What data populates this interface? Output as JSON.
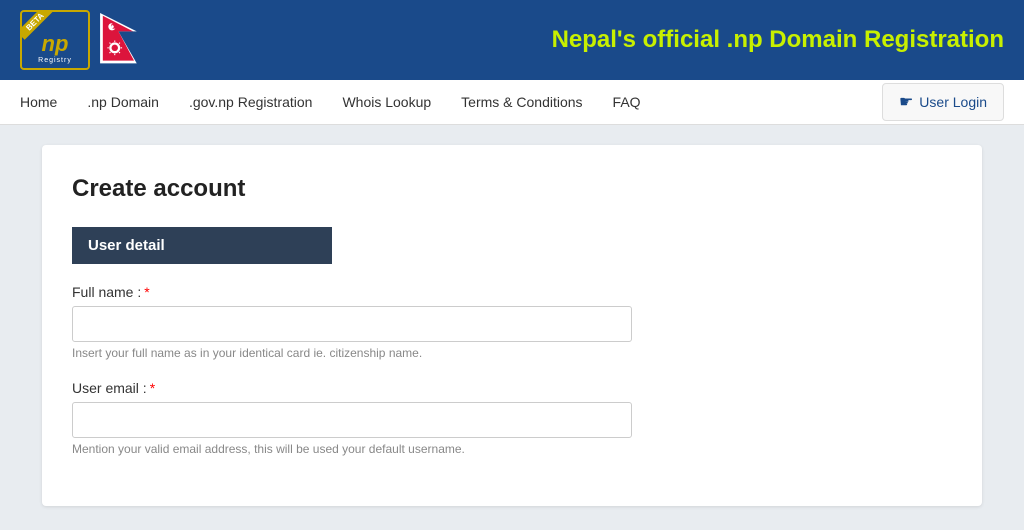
{
  "header": {
    "title": "Nepal's official .np Domain Registration",
    "logo_text": "np",
    "registry_label": "Registry",
    "beta_label": "BETA"
  },
  "navbar": {
    "items": [
      {
        "label": "Home",
        "id": "home"
      },
      {
        "label": ".np Domain",
        "id": "np-domain"
      },
      {
        "label": ".gov.np Registration",
        "id": "govnp-registration"
      },
      {
        "label": "Whois Lookup",
        "id": "whois-lookup"
      },
      {
        "label": "Terms & Conditions",
        "id": "terms-conditions"
      },
      {
        "label": "FAQ",
        "id": "faq"
      }
    ],
    "user_login_label": "User Login"
  },
  "form": {
    "title": "Create account",
    "section_header": "User detail",
    "fields": [
      {
        "label": "Full name :",
        "required": true,
        "type": "text",
        "placeholder": "",
        "hint": "Insert your full name as in your identical card ie. citizenship name.",
        "id": "full-name"
      },
      {
        "label": "User email :",
        "required": true,
        "type": "email",
        "placeholder": "",
        "hint": "Mention your valid email address, this will be used your default username.",
        "id": "user-email"
      }
    ]
  }
}
